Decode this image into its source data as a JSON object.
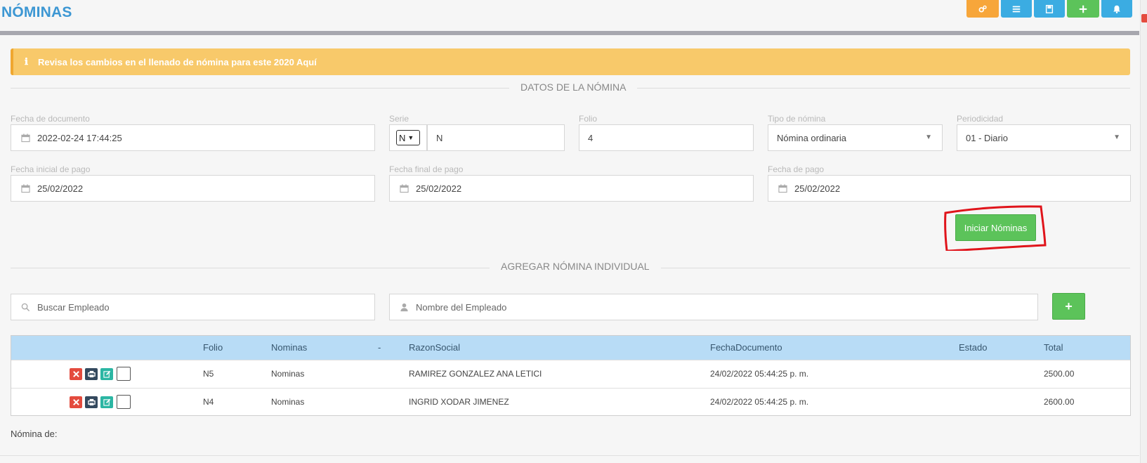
{
  "header": {
    "title": "NÓMINAS",
    "buttons": [
      {
        "icon": "cogs-icon",
        "color": "#f7a63a"
      },
      {
        "icon": "list-icon",
        "color": "#3bace2"
      },
      {
        "icon": "save-icon",
        "color": "#3bace2"
      },
      {
        "icon": "plus-icon",
        "color": "#5cc35a"
      },
      {
        "icon": "bell-icon",
        "color": "#3bace2"
      }
    ]
  },
  "alert": {
    "icon": "ℹ",
    "text": "Revisa los cambios en el llenado de nómina para este 2020 Aquí"
  },
  "datos": {
    "title": "DATOS DE LA NÓMINA",
    "fecha_documento": {
      "label": "Fecha de documento",
      "value": "2022-02-24 17:44:25"
    },
    "serie": {
      "label": "Serie",
      "select": "N",
      "value": "N"
    },
    "folio": {
      "label": "Folio",
      "value": "4"
    },
    "tipo_nomina": {
      "label": "Tipo de nómina",
      "value": "Nómina ordinaria"
    },
    "periodicidad": {
      "label": "Periodicidad",
      "value": "01 - Diario"
    },
    "fecha_inicial": {
      "label": "Fecha inicial de pago",
      "value": "25/02/2022"
    },
    "fecha_final": {
      "label": "Fecha final de pago",
      "value": "25/02/2022"
    },
    "fecha_pago": {
      "label": "Fecha de pago",
      "value": "25/02/2022"
    },
    "iniciar_label": "Iniciar Nóminas"
  },
  "individual": {
    "title": "AGREGAR NÓMINA INDIVIDUAL",
    "search_placeholder": "Buscar Empleado",
    "name_placeholder": "Nombre del Empleado",
    "add_label": "+"
  },
  "table": {
    "columns": [
      "Folio",
      "Nominas",
      "-",
      "RazonSocial",
      "FechaDocumento",
      "Estado",
      "Total"
    ],
    "rows": [
      {
        "folio": "N5",
        "nominas": "Nominas",
        "razon": "RAMIREZ GONZALEZ ANA LETICI",
        "fecha": "24/02/2022 05:44:25 p. m.",
        "estado": "",
        "total": "2500.00"
      },
      {
        "folio": "N4",
        "nominas": "Nominas",
        "razon": "INGRID XODAR JIMENEZ",
        "fecha": "24/02/2022 05:44:25 p. m.",
        "estado": "",
        "total": "2600.00"
      }
    ]
  },
  "footer": {
    "label": "Nómina de:"
  },
  "colors": {
    "accent": "#3d97d3",
    "success": "#5cc35a",
    "warning": "#f8c96a",
    "danger": "#e44b3e",
    "table_head": "#b8dcf6"
  }
}
